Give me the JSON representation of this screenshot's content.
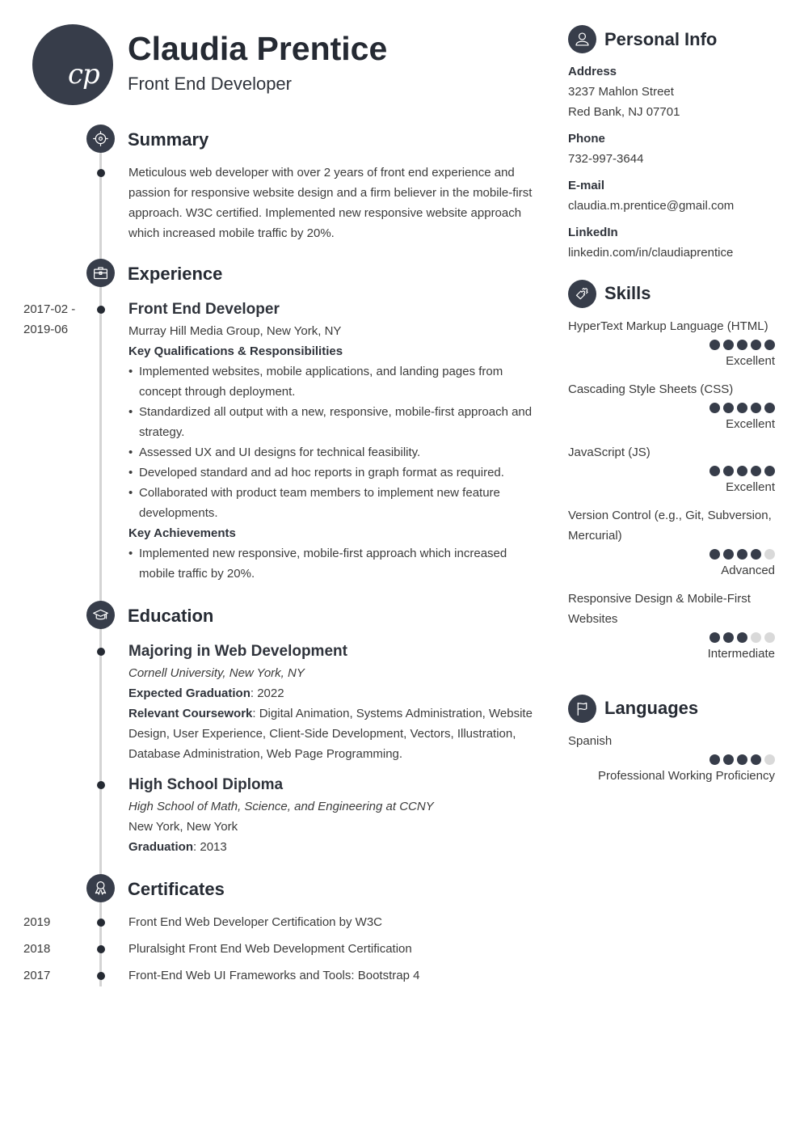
{
  "header": {
    "initials": "cp",
    "name": "Claudia Prentice",
    "job_title": "Front End Developer"
  },
  "theme": {
    "accent": "#373d4a",
    "text": "#3b3b3b",
    "timeline": "#d4d4d4",
    "rating_off": "#d9d9d9"
  },
  "summary": {
    "title": "Summary",
    "icon": "target-icon",
    "text": "Meticulous web developer with over 2 years of front end experience and passion for responsive website design and a firm believer in the mobile-first approach. W3C certified. Implemented new responsive website approach which increased mobile traffic by 20%."
  },
  "experience": {
    "title": "Experience",
    "icon": "briefcase-icon",
    "items": [
      {
        "date_start": "2017-02 -",
        "date_end": "2019-06",
        "role": "Front End Developer",
        "company": "Murray Hill Media Group, New York, NY",
        "qualifications_heading": "Key Qualifications & Responsibilities",
        "responsibilities": [
          "Implemented websites, mobile applications, and landing pages from concept through deployment.",
          "Standardized all output with a new, responsive, mobile-first approach and strategy.",
          "Assessed UX and UI designs for technical feasibility.",
          "Developed standard and ad hoc reports in graph format as required.",
          "Collaborated with product team members to implement new feature developments."
        ],
        "achievements_heading": "Key Achievements",
        "achievements": [
          "Implemented new responsive, mobile-first approach which increased mobile traffic by 20%."
        ]
      }
    ]
  },
  "education": {
    "title": "Education",
    "icon": "graduation-cap-icon",
    "items": [
      {
        "degree": "Majoring in Web Development",
        "school": "Cornell University, New York, NY",
        "grad_label": "Expected Graduation",
        "grad_value": ": 2022",
        "coursework_label": "Relevant Coursework",
        "coursework_value": ": Digital Animation, Systems Administration, Website Design, User Experience, Client-Side Development, Vectors, Illustration, Database Administration, Web Page Programming."
      },
      {
        "degree": "High School Diploma",
        "school": "High School of Math, Science, and Engineering at CCNY",
        "location": "New York, New York",
        "grad_label": "Graduation",
        "grad_value": ": 2013"
      }
    ]
  },
  "certificates": {
    "title": "Certificates",
    "icon": "award-ribbon-icon",
    "items": [
      {
        "year": "2019",
        "name": "Front End Web Developer Certification by W3C"
      },
      {
        "year": "2018",
        "name": "Pluralsight Front End Web Development Certification"
      },
      {
        "year": "2017",
        "name": "Front-End Web UI Frameworks and Tools: Bootstrap 4"
      }
    ]
  },
  "personal_info": {
    "title": "Personal Info",
    "icon": "user-icon",
    "address_label": "Address",
    "address_line1": "3237 Mahlon Street",
    "address_line2": "Red Bank, NJ 07701",
    "phone_label": "Phone",
    "phone": "732-997-3644",
    "email_label": "E-mail",
    "email": "claudia.m.prentice@gmail.com",
    "linkedin_label": "LinkedIn",
    "linkedin": "linkedin.com/in/claudiaprentice"
  },
  "skills": {
    "title": "Skills",
    "icon": "puzzle-piece-icon",
    "items": [
      {
        "name": "HyperText Markup Language (HTML)",
        "rating": 5,
        "max": 5,
        "level": "Excellent"
      },
      {
        "name": "Cascading Style Sheets (CSS)",
        "rating": 5,
        "max": 5,
        "level": "Excellent"
      },
      {
        "name": "JavaScript (JS)",
        "rating": 5,
        "max": 5,
        "level": "Excellent"
      },
      {
        "name": "Version Control (e.g., Git, Subversion, Mercurial)",
        "rating": 4,
        "max": 5,
        "level": "Advanced"
      },
      {
        "name": "Responsive Design & Mobile-First Websites",
        "rating": 3,
        "max": 5,
        "level": "Intermediate"
      }
    ]
  },
  "languages": {
    "title": "Languages",
    "icon": "flag-icon",
    "items": [
      {
        "name": "Spanish",
        "rating": 4,
        "max": 5,
        "level": "Professional Working Proficiency"
      }
    ]
  }
}
